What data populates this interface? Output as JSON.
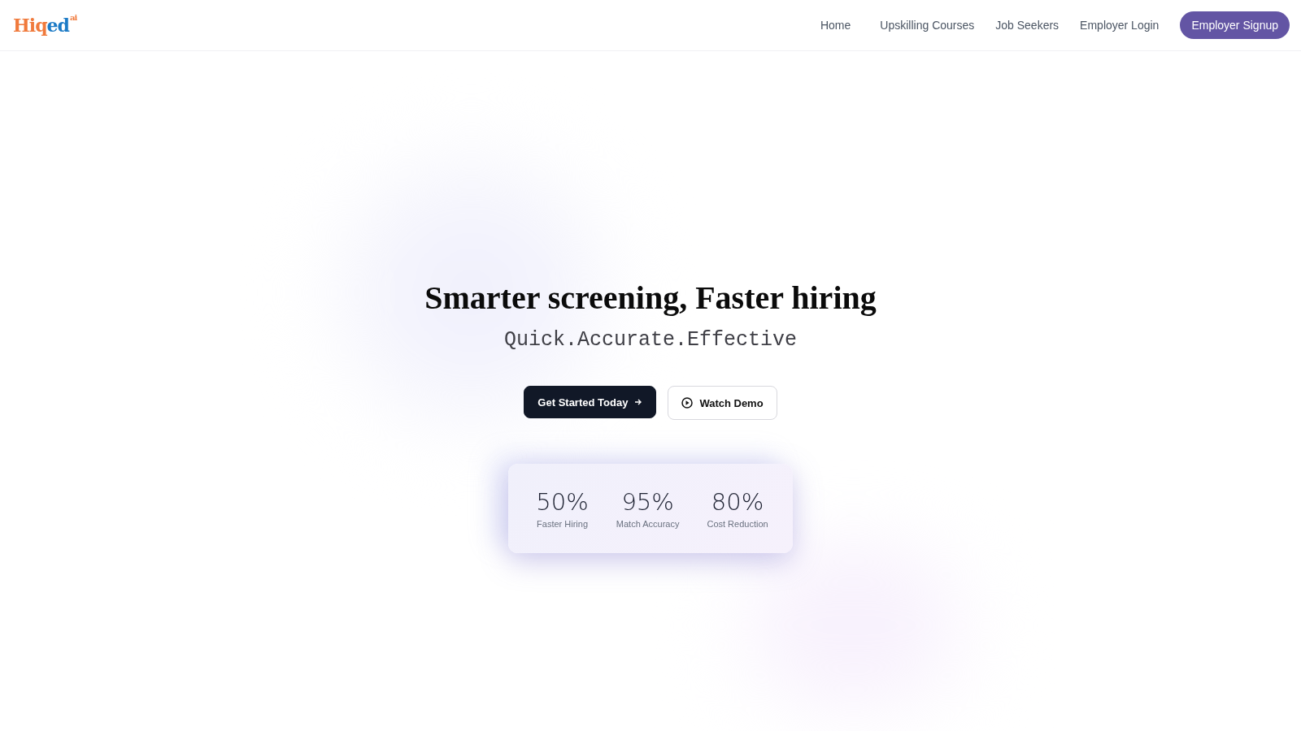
{
  "logo": {
    "part_a": "Hiq",
    "part_b": "ed",
    "suffix": "ai"
  },
  "nav": [
    {
      "label": "Home",
      "kind": "link"
    },
    {
      "label": "Upskilling Courses",
      "kind": "link"
    },
    {
      "label": "Job Seekers",
      "kind": "link"
    },
    {
      "label": "Employer Login",
      "kind": "link"
    },
    {
      "label": "Employer Signup",
      "kind": "cta"
    }
  ],
  "hero": {
    "title": "Smarter screening, Faster hiring",
    "subtitle": "Quick.Accurate.Effective",
    "buttons": [
      {
        "label": "Get Started Today",
        "kind": "primary"
      },
      {
        "label": "Watch Demo",
        "kind": "secondary"
      }
    ]
  },
  "stats": [
    {
      "value": "50%",
      "label": "Faster Hiring"
    },
    {
      "value": "95%",
      "label": "Match Accuracy"
    },
    {
      "value": "80%",
      "label": "Cost Reduction"
    }
  ]
}
